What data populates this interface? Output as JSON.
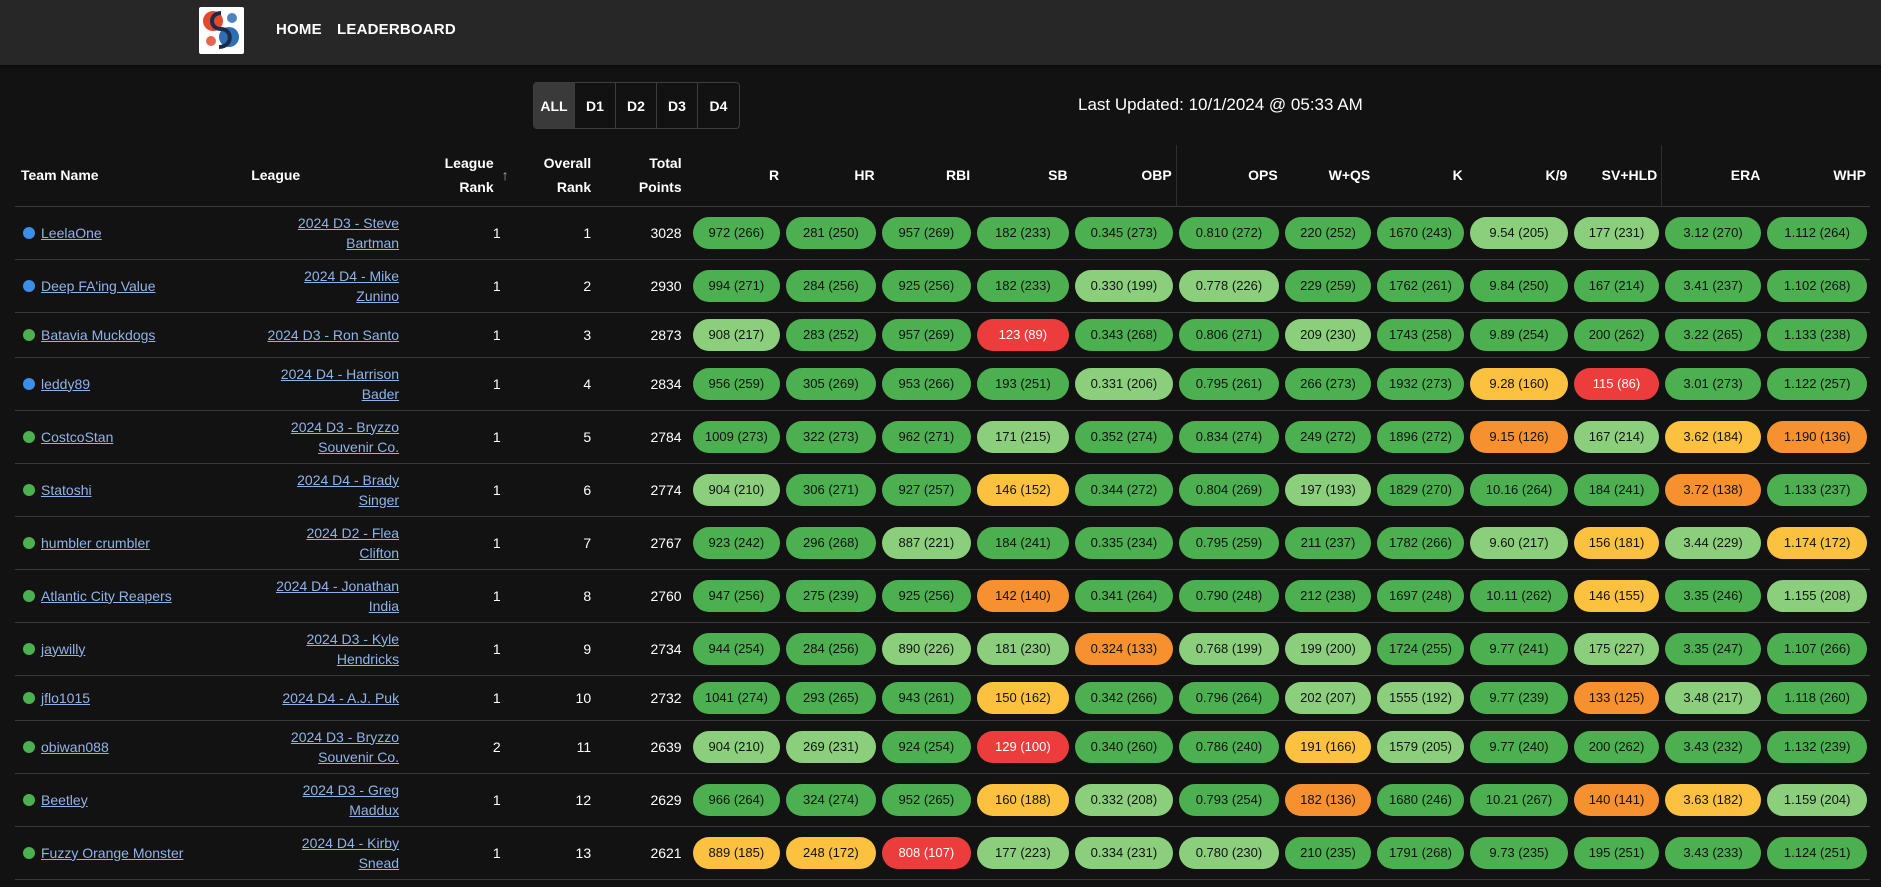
{
  "nav": {
    "home": "HOME",
    "leaderboard": "LEADERBOARD"
  },
  "filters": {
    "options": [
      "ALL",
      "D1",
      "D2",
      "D3",
      "D4"
    ],
    "selected": "ALL"
  },
  "last_updated": "Last Updated: 10/1/2024 @ 05:33 AM",
  "colors": {
    "dark_green": "#4caf50",
    "light_green": "#8bcf7d",
    "yellow": "#fbc13f",
    "orange": "#f7902f",
    "red": "#ec3c3c",
    "blue_dot": "#3d8ee6"
  },
  "table": {
    "headers": {
      "team": "Team Name",
      "league": "League",
      "league_rank_1": "League",
      "league_rank_2": "Rank",
      "overall_rank_1": "Overall",
      "overall_rank_2": "Rank",
      "total_1": "Total",
      "total_2": "Points",
      "stats": [
        "R",
        "HR",
        "RBI",
        "SB",
        "OBP",
        "OPS",
        "W+QS",
        "K",
        "K/9",
        "SV+HLD",
        "ERA",
        "WHP"
      ]
    },
    "sort_icon": "arrow-up-icon",
    "rows": [
      {
        "team": "LeelaOne",
        "dot": "blue",
        "league": [
          "2024 D3 - Steve",
          "Bartman"
        ],
        "league_rank": "1",
        "overall_rank": "1",
        "total": "3028",
        "stats": [
          "972 (266)",
          "281 (250)",
          "957 (269)",
          "182 (233)",
          "0.345 (273)",
          "0.810 (272)",
          "220 (252)",
          "1670 (243)",
          "9.54 (205)",
          "177 (231)",
          "3.12 (270)",
          "1.112 (264)"
        ],
        "colors": [
          "dg",
          "dg",
          "dg",
          "dg",
          "dg",
          "dg",
          "dg",
          "dg",
          "lg",
          "lg",
          "dg",
          "dg"
        ]
      },
      {
        "team": "Deep FA'ing Value",
        "dot": "blue",
        "league": [
          "2024 D4 - Mike",
          "Zunino"
        ],
        "league_rank": "1",
        "overall_rank": "2",
        "total": "2930",
        "stats": [
          "994 (271)",
          "284 (256)",
          "925 (256)",
          "182 (233)",
          "0.330 (199)",
          "0.778 (226)",
          "229 (259)",
          "1762 (261)",
          "9.84 (250)",
          "167 (214)",
          "3.41 (237)",
          "1.102 (268)"
        ],
        "colors": [
          "dg",
          "dg",
          "dg",
          "dg",
          "lg",
          "lg",
          "dg",
          "dg",
          "dg",
          "dg",
          "dg",
          "dg"
        ]
      },
      {
        "team": "Batavia Muckdogs",
        "dot": "green",
        "league": [
          "2024 D3 - Ron Santo"
        ],
        "league_rank": "1",
        "overall_rank": "3",
        "total": "2873",
        "stats": [
          "908 (217)",
          "283 (252)",
          "957 (269)",
          "123 (89)",
          "0.343 (268)",
          "0.806 (271)",
          "209 (230)",
          "1743 (258)",
          "9.89 (254)",
          "200 (262)",
          "3.22 (265)",
          "1.133 (238)"
        ],
        "colors": [
          "lg",
          "dg",
          "dg",
          "r",
          "dg",
          "dg",
          "lg",
          "dg",
          "dg",
          "dg",
          "dg",
          "dg"
        ]
      },
      {
        "team": "leddy89",
        "dot": "blue",
        "league": [
          "2024 D4 - Harrison",
          "Bader"
        ],
        "league_rank": "1",
        "overall_rank": "4",
        "total": "2834",
        "stats": [
          "956 (259)",
          "305 (269)",
          "953 (266)",
          "193 (251)",
          "0.331 (206)",
          "0.795 (261)",
          "266 (273)",
          "1932 (273)",
          "9.28 (160)",
          "115 (86)",
          "3.01 (273)",
          "1.122 (257)"
        ],
        "colors": [
          "dg",
          "dg",
          "dg",
          "dg",
          "lg",
          "dg",
          "dg",
          "dg",
          "y",
          "r",
          "dg",
          "dg"
        ]
      },
      {
        "team": "CostcoStan",
        "dot": "green",
        "league": [
          "2024 D3 - Bryzzo",
          "Souvenir Co."
        ],
        "league_rank": "1",
        "overall_rank": "5",
        "total": "2784",
        "stats": [
          "1009 (273)",
          "322 (273)",
          "962 (271)",
          "171 (215)",
          "0.352 (274)",
          "0.834 (274)",
          "249 (272)",
          "1896 (272)",
          "9.15 (126)",
          "167 (214)",
          "3.62 (184)",
          "1.190 (136)"
        ],
        "colors": [
          "dg",
          "dg",
          "dg",
          "lg",
          "dg",
          "dg",
          "dg",
          "dg",
          "o",
          "lg",
          "y",
          "o"
        ]
      },
      {
        "team": "Statoshi",
        "dot": "green",
        "league": [
          "2024 D4 - Brady",
          "Singer"
        ],
        "league_rank": "1",
        "overall_rank": "6",
        "total": "2774",
        "stats": [
          "904 (210)",
          "306 (271)",
          "927 (257)",
          "146 (152)",
          "0.344 (272)",
          "0.804 (269)",
          "197 (193)",
          "1829 (270)",
          "10.16 (264)",
          "184 (241)",
          "3.72 (138)",
          "1.133 (237)"
        ],
        "colors": [
          "lg",
          "dg",
          "dg",
          "y",
          "dg",
          "dg",
          "lg",
          "dg",
          "dg",
          "dg",
          "o",
          "dg"
        ]
      },
      {
        "team": "humbler crumbler",
        "dot": "green",
        "league": [
          "2024 D2 - Flea",
          "Clifton"
        ],
        "league_rank": "1",
        "overall_rank": "7",
        "total": "2767",
        "stats": [
          "923 (242)",
          "296 (268)",
          "887 (221)",
          "184 (241)",
          "0.335 (234)",
          "0.795 (259)",
          "211 (237)",
          "1782 (266)",
          "9.60 (217)",
          "156 (181)",
          "3.44 (229)",
          "1.174 (172)"
        ],
        "colors": [
          "dg",
          "dg",
          "lg",
          "dg",
          "dg",
          "dg",
          "dg",
          "dg",
          "lg",
          "y",
          "lg",
          "y"
        ]
      },
      {
        "team": "Atlantic City Reapers",
        "dot": "green",
        "league": [
          "2024 D4 - Jonathan",
          "India"
        ],
        "league_rank": "1",
        "overall_rank": "8",
        "total": "2760",
        "stats": [
          "947 (256)",
          "275 (239)",
          "925 (256)",
          "142 (140)",
          "0.341 (264)",
          "0.790 (248)",
          "212 (238)",
          "1697 (248)",
          "10.11 (262)",
          "146 (155)",
          "3.35 (246)",
          "1.155 (208)"
        ],
        "colors": [
          "dg",
          "dg",
          "dg",
          "o",
          "dg",
          "dg",
          "dg",
          "dg",
          "dg",
          "y",
          "dg",
          "lg"
        ]
      },
      {
        "team": "jaywilly",
        "dot": "green",
        "league": [
          "2024 D3 - Kyle",
          "Hendricks"
        ],
        "league_rank": "1",
        "overall_rank": "9",
        "total": "2734",
        "stats": [
          "944 (254)",
          "284 (256)",
          "890 (226)",
          "181 (230)",
          "0.324 (133)",
          "0.768 (199)",
          "199 (200)",
          "1724 (255)",
          "9.77 (241)",
          "175 (227)",
          "3.35 (247)",
          "1.107 (266)"
        ],
        "colors": [
          "dg",
          "dg",
          "lg",
          "lg",
          "o",
          "lg",
          "lg",
          "dg",
          "dg",
          "lg",
          "dg",
          "dg"
        ]
      },
      {
        "team": "jflo1015",
        "dot": "green",
        "league": [
          "2024 D4 - A.J. Puk"
        ],
        "league_rank": "1",
        "overall_rank": "10",
        "total": "2732",
        "stats": [
          "1041 (274)",
          "293 (265)",
          "943 (261)",
          "150 (162)",
          "0.342 (266)",
          "0.796 (264)",
          "202 (207)",
          "1555 (192)",
          "9.77 (239)",
          "133 (125)",
          "3.48 (217)",
          "1.118 (260)"
        ],
        "colors": [
          "dg",
          "dg",
          "dg",
          "y",
          "dg",
          "dg",
          "lg",
          "lg",
          "dg",
          "o",
          "lg",
          "dg"
        ]
      },
      {
        "team": "obiwan088",
        "dot": "green",
        "league": [
          "2024 D3 - Bryzzo",
          "Souvenir Co."
        ],
        "league_rank": "2",
        "overall_rank": "11",
        "total": "2639",
        "stats": [
          "904 (210)",
          "269 (231)",
          "924 (254)",
          "129 (100)",
          "0.340 (260)",
          "0.786 (240)",
          "191 (166)",
          "1579 (205)",
          "9.77 (240)",
          "200 (262)",
          "3.43 (232)",
          "1.132 (239)"
        ],
        "colors": [
          "lg",
          "lg",
          "dg",
          "r",
          "dg",
          "dg",
          "y",
          "lg",
          "dg",
          "dg",
          "dg",
          "dg"
        ]
      },
      {
        "team": "Beetley",
        "dot": "green",
        "league": [
          "2024 D3 - Greg",
          "Maddux"
        ],
        "league_rank": "1",
        "overall_rank": "12",
        "total": "2629",
        "stats": [
          "966 (264)",
          "324 (274)",
          "952 (265)",
          "160 (188)",
          "0.332 (208)",
          "0.793 (254)",
          "182 (136)",
          "1680 (246)",
          "10.21 (267)",
          "140 (141)",
          "3.63 (182)",
          "1.159 (204)"
        ],
        "colors": [
          "dg",
          "dg",
          "dg",
          "y",
          "lg",
          "dg",
          "o",
          "dg",
          "dg",
          "o",
          "y",
          "lg"
        ]
      },
      {
        "team": "Fuzzy Orange Monster",
        "dot": "green",
        "league": [
          "2024 D4 - Kirby",
          "Snead"
        ],
        "league_rank": "1",
        "overall_rank": "13",
        "total": "2621",
        "stats": [
          "889 (185)",
          "248 (172)",
          "808 (107)",
          "177 (223)",
          "0.334 (231)",
          "0.780 (230)",
          "210 (235)",
          "1791 (268)",
          "9.73 (235)",
          "195 (251)",
          "3.43 (233)",
          "1.124 (251)"
        ],
        "colors": [
          "y",
          "y",
          "r",
          "lg",
          "lg",
          "lg",
          "dg",
          "dg",
          "dg",
          "dg",
          "dg",
          "dg"
        ]
      }
    ]
  }
}
